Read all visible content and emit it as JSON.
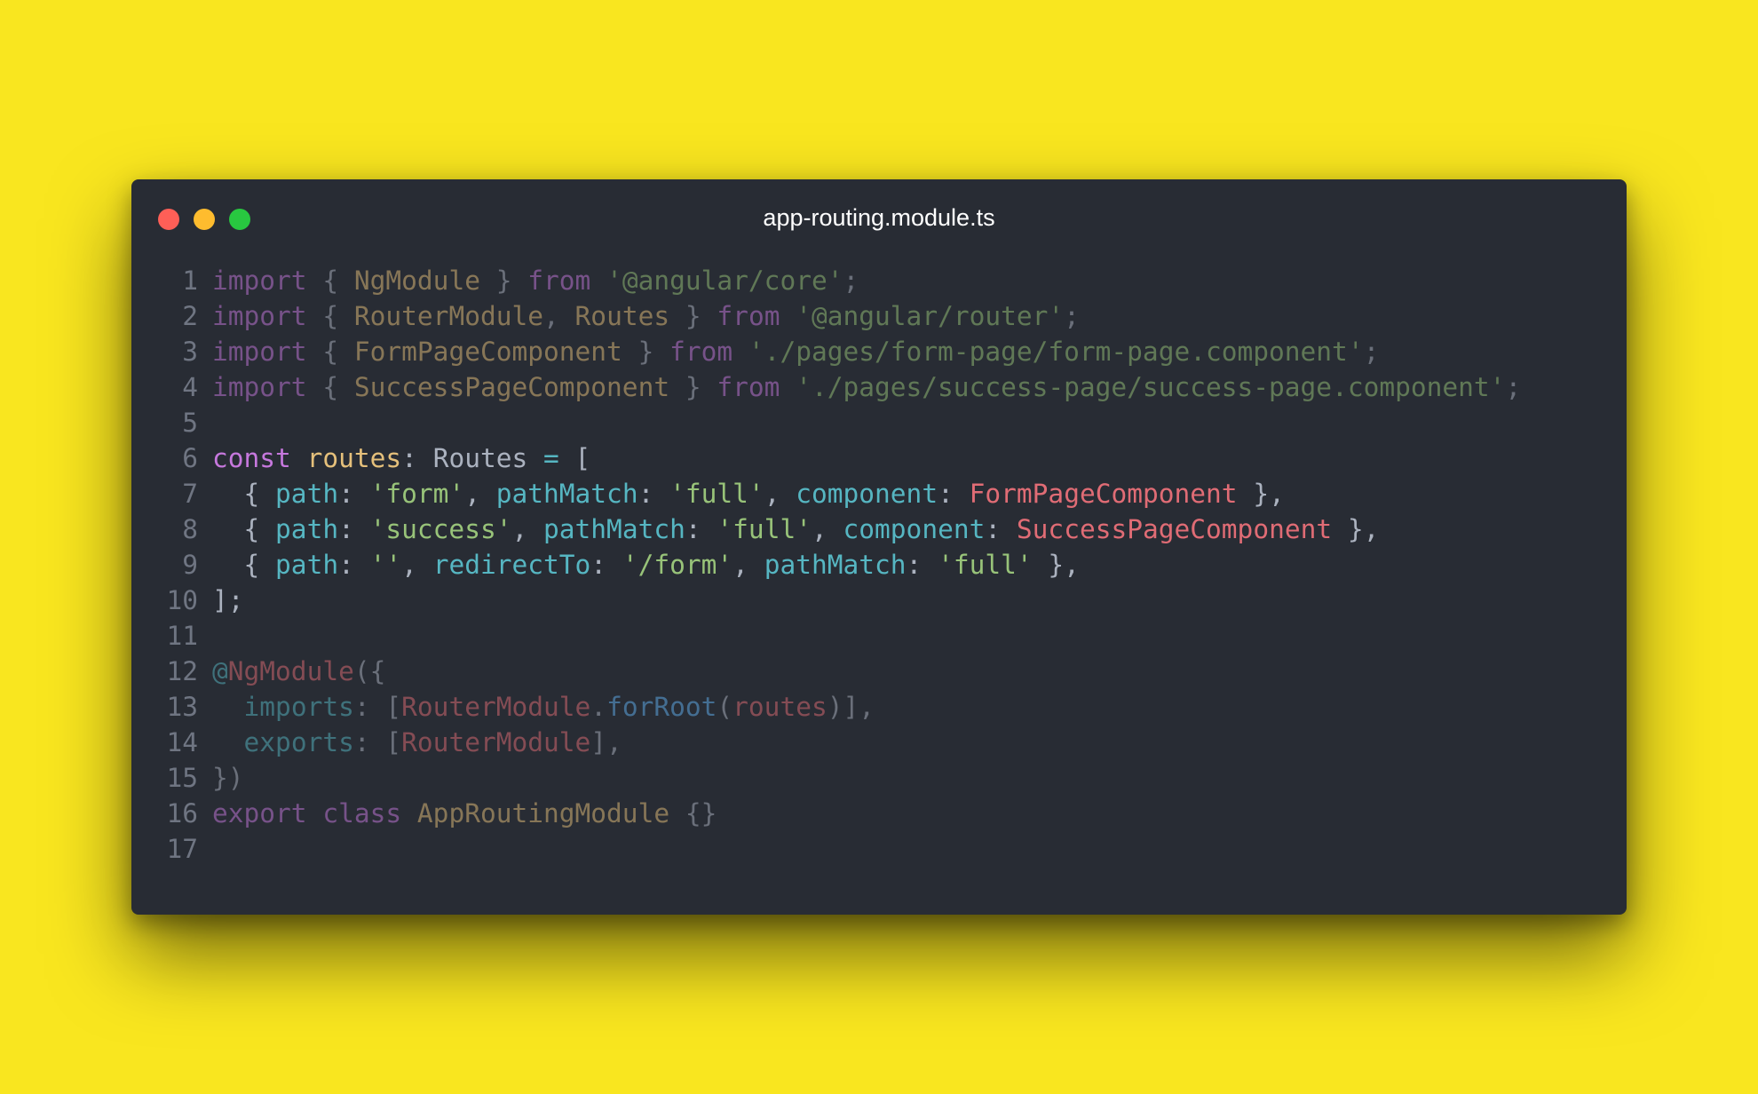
{
  "window": {
    "title": "app-routing.module.ts",
    "controls": [
      {
        "name": "close",
        "color": "#fe5f57"
      },
      {
        "name": "minimize",
        "color": "#febc2e"
      },
      {
        "name": "maximize",
        "color": "#28c840"
      }
    ]
  },
  "colors": {
    "background": "#f9e61f",
    "editor": "#282c34",
    "keyword": "#c678dd",
    "string": "#98c379",
    "property": "#56b6c2",
    "class": "#e06c75",
    "type": "#e5c07b",
    "line_number": "#6f7582"
  },
  "code": {
    "line_numbers": [
      "1",
      "2",
      "3",
      "4",
      "5",
      "6",
      "7",
      "8",
      "9",
      "10",
      "11",
      "12",
      "13",
      "14",
      "15",
      "16",
      "17"
    ],
    "lines": [
      {
        "dim": true,
        "tokens": [
          {
            "t": "import",
            "c": "kw"
          },
          {
            "t": " { ",
            "c": "punc"
          },
          {
            "t": "NgModule",
            "c": "type"
          },
          {
            "t": " } ",
            "c": "punc"
          },
          {
            "t": "from",
            "c": "kw"
          },
          {
            "t": " ",
            "c": "punc"
          },
          {
            "t": "'@angular/core'",
            "c": "str"
          },
          {
            "t": ";",
            "c": "punc"
          }
        ]
      },
      {
        "dim": true,
        "tokens": [
          {
            "t": "import",
            "c": "kw"
          },
          {
            "t": " { ",
            "c": "punc"
          },
          {
            "t": "RouterModule",
            "c": "type"
          },
          {
            "t": ", ",
            "c": "punc"
          },
          {
            "t": "Routes",
            "c": "type"
          },
          {
            "t": " } ",
            "c": "punc"
          },
          {
            "t": "from",
            "c": "kw"
          },
          {
            "t": " ",
            "c": "punc"
          },
          {
            "t": "'@angular/router'",
            "c": "str"
          },
          {
            "t": ";",
            "c": "punc"
          }
        ]
      },
      {
        "dim": true,
        "tokens": [
          {
            "t": "import",
            "c": "kw"
          },
          {
            "t": " { ",
            "c": "punc"
          },
          {
            "t": "FormPageComponent",
            "c": "type"
          },
          {
            "t": " } ",
            "c": "punc"
          },
          {
            "t": "from",
            "c": "kw"
          },
          {
            "t": " ",
            "c": "punc"
          },
          {
            "t": "'./pages/form-page/form-page.component'",
            "c": "str"
          },
          {
            "t": ";",
            "c": "punc"
          }
        ]
      },
      {
        "dim": true,
        "tokens": [
          {
            "t": "import",
            "c": "kw"
          },
          {
            "t": " { ",
            "c": "punc"
          },
          {
            "t": "SuccessPageComponent",
            "c": "type"
          },
          {
            "t": " } ",
            "c": "punc"
          },
          {
            "t": "from",
            "c": "kw"
          },
          {
            "t": " ",
            "c": "punc"
          },
          {
            "t": "'./pages/success-page/success-page.component'",
            "c": "str"
          },
          {
            "t": ";",
            "c": "punc"
          }
        ]
      },
      {
        "dim": false,
        "tokens": []
      },
      {
        "dim": false,
        "tokens": [
          {
            "t": "const",
            "c": "kw"
          },
          {
            "t": " ",
            "c": "punc"
          },
          {
            "t": "routes",
            "c": "var"
          },
          {
            "t": ": ",
            "c": "punc"
          },
          {
            "t": "Routes",
            "c": "punc"
          },
          {
            "t": " ",
            "c": "punc"
          },
          {
            "t": "=",
            "c": "op"
          },
          {
            "t": " [",
            "c": "punc"
          }
        ]
      },
      {
        "dim": false,
        "tokens": [
          {
            "t": "  { ",
            "c": "punc"
          },
          {
            "t": "path",
            "c": "prop"
          },
          {
            "t": ": ",
            "c": "punc"
          },
          {
            "t": "'form'",
            "c": "str"
          },
          {
            "t": ", ",
            "c": "punc"
          },
          {
            "t": "pathMatch",
            "c": "prop"
          },
          {
            "t": ": ",
            "c": "punc"
          },
          {
            "t": "'full'",
            "c": "str"
          },
          {
            "t": ", ",
            "c": "punc"
          },
          {
            "t": "component",
            "c": "prop"
          },
          {
            "t": ": ",
            "c": "punc"
          },
          {
            "t": "FormPageComponent",
            "c": "cls"
          },
          {
            "t": " },",
            "c": "punc"
          }
        ]
      },
      {
        "dim": false,
        "tokens": [
          {
            "t": "  { ",
            "c": "punc"
          },
          {
            "t": "path",
            "c": "prop"
          },
          {
            "t": ": ",
            "c": "punc"
          },
          {
            "t": "'success'",
            "c": "str"
          },
          {
            "t": ", ",
            "c": "punc"
          },
          {
            "t": "pathMatch",
            "c": "prop"
          },
          {
            "t": ": ",
            "c": "punc"
          },
          {
            "t": "'full'",
            "c": "str"
          },
          {
            "t": ", ",
            "c": "punc"
          },
          {
            "t": "component",
            "c": "prop"
          },
          {
            "t": ": ",
            "c": "punc"
          },
          {
            "t": "SuccessPageComponent",
            "c": "cls"
          },
          {
            "t": " },",
            "c": "punc"
          }
        ]
      },
      {
        "dim": false,
        "tokens": [
          {
            "t": "  { ",
            "c": "punc"
          },
          {
            "t": "path",
            "c": "prop"
          },
          {
            "t": ": ",
            "c": "punc"
          },
          {
            "t": "''",
            "c": "str"
          },
          {
            "t": ", ",
            "c": "punc"
          },
          {
            "t": "redirectTo",
            "c": "prop"
          },
          {
            "t": ": ",
            "c": "punc"
          },
          {
            "t": "'/form'",
            "c": "str"
          },
          {
            "t": ", ",
            "c": "punc"
          },
          {
            "t": "pathMatch",
            "c": "prop"
          },
          {
            "t": ": ",
            "c": "punc"
          },
          {
            "t": "'full'",
            "c": "str"
          },
          {
            "t": " },",
            "c": "punc"
          }
        ]
      },
      {
        "dim": false,
        "tokens": [
          {
            "t": "];",
            "c": "punc"
          }
        ]
      },
      {
        "dim": true,
        "tokens": []
      },
      {
        "dim": true,
        "tokens": [
          {
            "t": "@",
            "c": "deco"
          },
          {
            "t": "NgModule",
            "c": "cls"
          },
          {
            "t": "({",
            "c": "punc"
          }
        ]
      },
      {
        "dim": true,
        "tokens": [
          {
            "t": "  ",
            "c": "punc"
          },
          {
            "t": "imports",
            "c": "prop"
          },
          {
            "t": ": [",
            "c": "punc"
          },
          {
            "t": "RouterModule",
            "c": "cls"
          },
          {
            "t": ".",
            "c": "punc"
          },
          {
            "t": "forRoot",
            "c": "fn"
          },
          {
            "t": "(",
            "c": "punc"
          },
          {
            "t": "routes",
            "c": "cls"
          },
          {
            "t": ")],",
            "c": "punc"
          }
        ]
      },
      {
        "dim": true,
        "tokens": [
          {
            "t": "  ",
            "c": "punc"
          },
          {
            "t": "exports",
            "c": "prop"
          },
          {
            "t": ": [",
            "c": "punc"
          },
          {
            "t": "RouterModule",
            "c": "cls"
          },
          {
            "t": "],",
            "c": "punc"
          }
        ]
      },
      {
        "dim": true,
        "tokens": [
          {
            "t": "})",
            "c": "punc"
          }
        ]
      },
      {
        "dim": true,
        "tokens": [
          {
            "t": "export",
            "c": "kw"
          },
          {
            "t": " ",
            "c": "punc"
          },
          {
            "t": "class",
            "c": "kw"
          },
          {
            "t": " ",
            "c": "punc"
          },
          {
            "t": "AppRoutingModule",
            "c": "type"
          },
          {
            "t": " {}",
            "c": "punc"
          }
        ]
      },
      {
        "dim": true,
        "tokens": []
      }
    ]
  }
}
